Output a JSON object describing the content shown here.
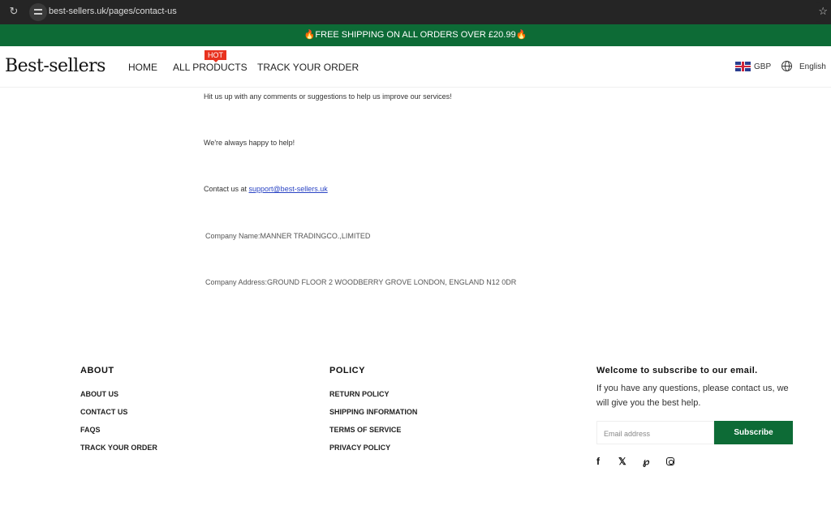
{
  "browser": {
    "url": "best-sellers.uk/pages/contact-us"
  },
  "announcement": {
    "text": "🔥FREE SHIPPING ON ALL ORDERS OVER £20.99🔥"
  },
  "header": {
    "logo": "Best-sellers",
    "nav": [
      {
        "label": "HOME"
      },
      {
        "label": "ALL PRODUCTS",
        "badge": "HOT"
      },
      {
        "label": "TRACK YOUR ORDER"
      }
    ],
    "currency": "GBP",
    "language": "English"
  },
  "content": {
    "line1": "Hit us up with any comments or suggestions to help us improve our services!",
    "line2": "We're always happy to help!",
    "contact_prefix": "Contact us at ",
    "contact_email": "support@best-sellers.uk",
    "company_name": "Company Name:MANNER TRADINGCO.,LIMITED",
    "company_address": "Company Address:GROUND FLOOR 2 WOODBERRY GROVE LONDON, ENGLAND N12 0DR"
  },
  "footer": {
    "about": {
      "heading": "ABOUT",
      "links": [
        "ABOUT US",
        "CONTACT US",
        "FAQS",
        "TRACK YOUR ORDER"
      ]
    },
    "policy": {
      "heading": "POLICY",
      "links": [
        "RETURN POLICY",
        "SHIPPING INFORMATION",
        "TERMS OF SERVICE",
        "PRIVACY POLICY"
      ]
    },
    "subscribe": {
      "title": "Welcome to subscribe to our email.",
      "description": "If you have any questions, please contact us, we will give you the best help.",
      "email_placeholder": "Email address",
      "button": "Subscribe"
    },
    "social": [
      "facebook",
      "x",
      "pinterest",
      "instagram"
    ]
  },
  "colors": {
    "brand_green": "#0d6b36",
    "hot_badge": "#e8321f",
    "link": "#2a44c4"
  }
}
